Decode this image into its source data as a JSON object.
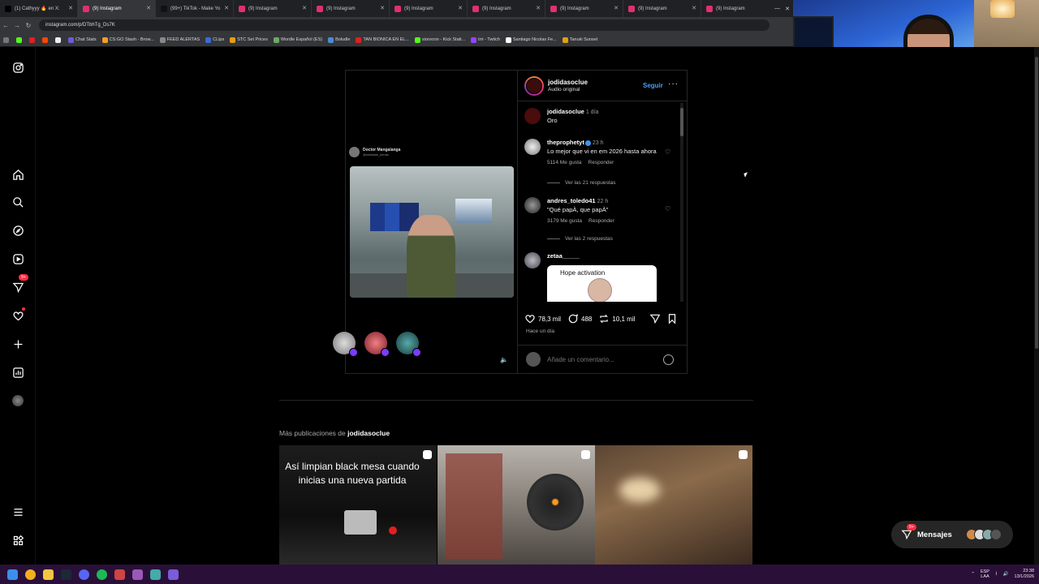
{
  "browser": {
    "tabs": [
      {
        "label": "(1) Cathyyy 🔥 en X:",
        "color": "#000000"
      },
      {
        "label": "(9) Instagram",
        "color": "#e1306c"
      },
      {
        "label": "(99+) TikTok - Make Yo",
        "color": "#111111"
      },
      {
        "label": "(9) Instagram",
        "color": "#e1306c"
      },
      {
        "label": "(9) Instagram",
        "color": "#e1306c"
      },
      {
        "label": "(9) Instagram",
        "color": "#e1306c"
      },
      {
        "label": "(9) Instagram",
        "color": "#e1306c"
      },
      {
        "label": "(9) Instagram",
        "color": "#e1306c"
      },
      {
        "label": "(9) Instagram",
        "color": "#e1306c"
      },
      {
        "label": "(9) Instagram",
        "color": "#e1306c"
      }
    ],
    "url": "instagram.com/p/DTbhTg_Ds7K",
    "bookmarks": [
      {
        "label": "Chat Stats",
        "color": "#6b5bd6"
      },
      {
        "label": "CS:GO Stash - Brow...",
        "color": "#f0a020"
      },
      {
        "label": "FEED ALERTAS",
        "color": "#888888"
      },
      {
        "label": "CLips",
        "color": "#3a6bd8"
      },
      {
        "label": "STC Set Prices",
        "color": "#e0a010"
      },
      {
        "label": "Wordle Español (ES)",
        "color": "#6aaa64"
      },
      {
        "label": "Boludle",
        "color": "#4a8ad8"
      },
      {
        "label": "TAN BIONICA EN EL...",
        "color": "#e02020"
      },
      {
        "label": "sionxron - Kick Stati...",
        "color": "#53fc18"
      },
      {
        "label": "trri - Twitch",
        "color": "#9146ff"
      },
      {
        "label": "Santiago Nicolas Fe...",
        "color": "#ffffff"
      },
      {
        "label": "Tanuki Sunset",
        "color": "#e0a010"
      }
    ]
  },
  "sidebar": {
    "items": [
      {
        "name": "instagram-logo-icon"
      },
      {
        "name": "home-icon"
      },
      {
        "name": "search-icon"
      },
      {
        "name": "explore-icon"
      },
      {
        "name": "reels-icon"
      },
      {
        "name": "messages-icon",
        "badge": "9+"
      },
      {
        "name": "notifications-heart-icon"
      },
      {
        "name": "create-plus-icon"
      },
      {
        "name": "dashboard-icon"
      },
      {
        "name": "profile-avatar"
      },
      {
        "name": "more-menu-icon"
      },
      {
        "name": "meta-apps-icon"
      }
    ]
  },
  "post": {
    "username": "jodidasoclue",
    "audio": "Audio original",
    "follow": "Seguir",
    "tweet": {
      "name": "Doctor Mangalanga",
      "handle": "@soltalaia_tomas"
    },
    "comments": [
      {
        "user": "jodidasoclue",
        "time": "1 día",
        "text": "Oro"
      },
      {
        "user": "theprophetyt",
        "time": "23 h",
        "text": "Lo mejor que vi en em 2026 hasta ahora",
        "likes": "5114 Me gusta",
        "reply": "Responder",
        "replies": "Ver las 21 respuestas"
      },
      {
        "user": "andres_toledo41",
        "time": "22 h",
        "text": "\"Qué papÀ, que papÀ\"",
        "likes": "3179 Me gusta",
        "reply": "Responder",
        "replies": "Ver las 2 respuestas"
      },
      {
        "user": "zetaa_____",
        "sticker": "Hope activation"
      }
    ],
    "likes": "78,3 mil",
    "comments_count": "488",
    "reposts": "10,1 mil",
    "date": "Hace un día",
    "comment_placeholder": "Añade un comentario..."
  },
  "more_posts": {
    "prefix": "Más publicaciones de ",
    "user": "jodidasoclue",
    "thumb1_text": "Así limpian black mesa cuando inicias una nueva partida"
  },
  "messages": {
    "label": "Mensajes",
    "badge": "9+"
  },
  "taskbar": {
    "lang1": "ESP",
    "lang2": "LAA",
    "time": "23:38",
    "date": "13/1/2026"
  }
}
